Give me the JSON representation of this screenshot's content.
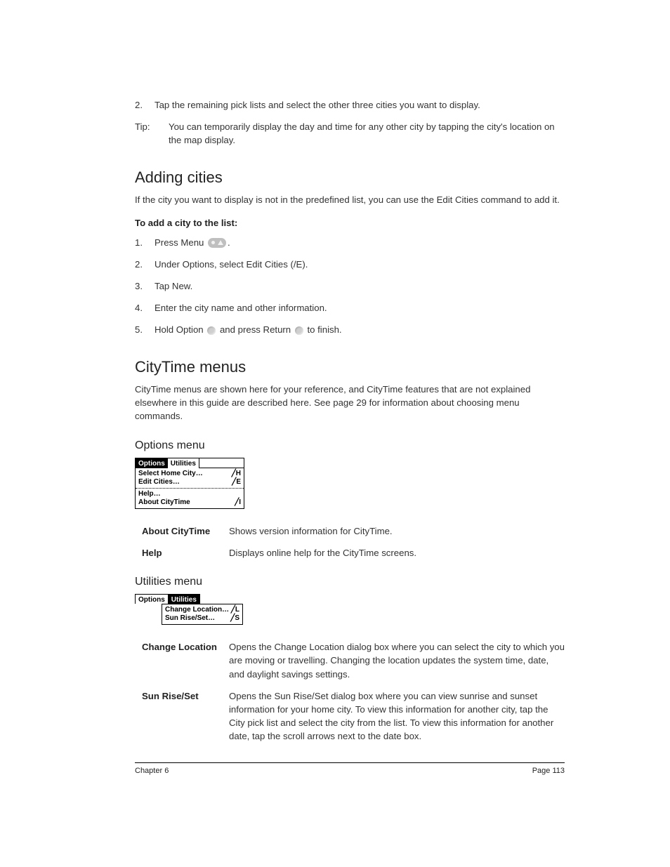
{
  "top": {
    "step2_num": "2.",
    "step2_text": "Tap the remaining pick lists and select the other three cities you want to display.",
    "tip_label": "Tip:",
    "tip_text": "You can temporarily display the day and time for any other city by tapping the city's location on the map display."
  },
  "adding_cities": {
    "heading": "Adding cities",
    "intro": "If the city you want to display is not in the predefined list, you can use the Edit Cities command to add it.",
    "sub": "To add a city to the list:",
    "s1_num": "1.",
    "s1_a": "Press Menu ",
    "s1_b": ".",
    "s2_num": "2.",
    "s2_text": "Under Options, select Edit Cities (/E).",
    "s3_num": "3.",
    "s3_text": "Tap New.",
    "s4_num": "4.",
    "s4_text": "Enter the city name and other information.",
    "s5_num": "5.",
    "s5_a": "Hold Option ",
    "s5_b": " and press Return ",
    "s5_c": " to finish."
  },
  "citytime": {
    "heading": "CityTime menus",
    "intro": "CityTime menus are shown here for your reference, and CityTime features that are not explained elsewhere in this guide are described here. See page 29 for information about choosing menu commands."
  },
  "options_menu": {
    "heading": "Options menu",
    "tab_options": "Options",
    "tab_utilities": "Utilities",
    "item1": "Select Home City…",
    "sc1": "╱H",
    "item2": "Edit Cities…",
    "sc2": "╱E",
    "item3": "Help…",
    "item4": "About CityTime",
    "sc4": "╱I",
    "desc1_term": "About CityTime",
    "desc1_def": "Shows version information for CityTime.",
    "desc2_term": "Help",
    "desc2_def": "Displays online help for the CityTime screens."
  },
  "utilities_menu": {
    "heading": "Utilities menu",
    "tab_options": "Options",
    "tab_utilities": "Utilities",
    "item1": "Change Location…",
    "sc1": "╱L",
    "item2": "Sun Rise/Set…",
    "sc2": "╱S",
    "desc1_term": "Change Location",
    "desc1_def": "Opens the Change Location dialog box where you can select the city to which you are moving or travelling. Changing the location updates the system time, date, and daylight savings settings.",
    "desc2_term": "Sun Rise/Set",
    "desc2_def": "Opens the Sun Rise/Set dialog box where you can view sunrise and sunset information for your home city. To view this information for another city, tap the City pick list and select the city from the list. To view this information for another date, tap the scroll arrows next to the date box."
  },
  "footer": {
    "left": "Chapter 6",
    "right": "Page 113"
  }
}
